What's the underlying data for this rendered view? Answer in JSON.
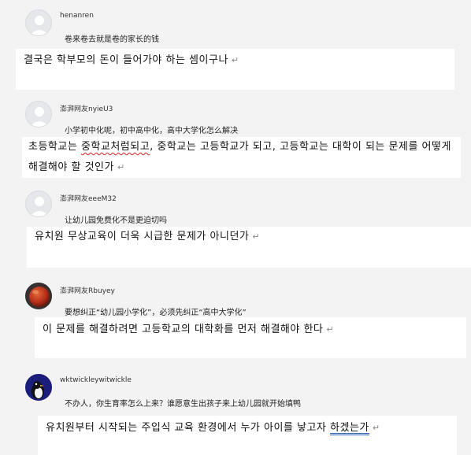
{
  "comments": [
    {
      "username": "henanren",
      "comment": "卷来卷去就是卷的家长的钱",
      "translation": "결국은 학부모의 돈이 들어가야 하는 셈이구나",
      "avatar_icon": "default-avatar-icon"
    },
    {
      "username": "澎湃网友nyieU3",
      "comment": "小学初中化呢，初中高中化，高中大学化怎么解决",
      "translation_parts": [
        "초등학교는 ",
        "중학교처럼되고",
        ", 중학교는 고등학교가 되고, 고등학교는 대학이 되는 문제를 어떻게 해결해야 할 것인가"
      ],
      "avatar_icon": "default-avatar-icon"
    },
    {
      "username": "澎湃网友eeeM32",
      "comment": "让幼儿园免费化不是更迫切吗",
      "translation": "유치원 무상교육이 더욱 시급한 문제가 아니던가",
      "avatar_icon": "default-avatar-icon"
    },
    {
      "username": "澎湃网友Rbuyey",
      "comment": "要想纠正“幼儿园小学化”，必须先纠正“高中大学化”",
      "translation": "이 문제를 해결하려면 고등학교의 대학화를 먼저 해결해야 한다",
      "avatar_icon": "red-sphere-avatar-icon"
    },
    {
      "username": "wktwickleywitwickle",
      "comment": "不办人，你生育率怎么上来？谁愿意生出孩子来上幼儿园就开始填鸭",
      "translation_parts": [
        "유치원부터 시작되는 주입식 교육 환경에서 누가 아이를 낳고자 ",
        "하겠는가"
      ],
      "avatar_icon": "penguin-avatar-icon"
    }
  ],
  "return_mark": "↵",
  "colors": {
    "background": "#f3f3f3",
    "box": "#ffffff",
    "spellcheck": "#d62020",
    "grammar": "#2d5fb5"
  }
}
